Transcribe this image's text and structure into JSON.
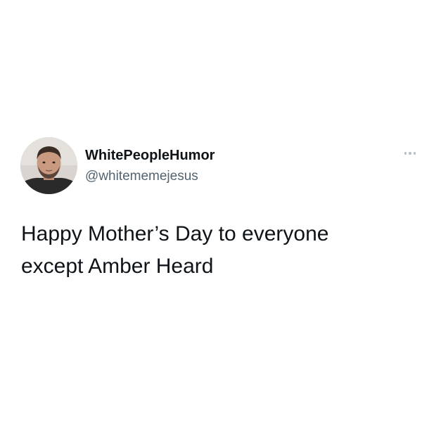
{
  "tweet": {
    "author": {
      "display_name": "WhitePeopleHumor",
      "handle": "@whitememejesus",
      "avatar_icon": "profile-photo"
    },
    "more_icon": "more-horizontal-icon",
    "text": "Happy Mother’s Day to everyone\nexcept Amber Heard"
  },
  "colors": {
    "background": "#ffffff",
    "text_primary": "#0f1419",
    "text_secondary": "#536471",
    "icon_muted": "#b7bec4"
  }
}
